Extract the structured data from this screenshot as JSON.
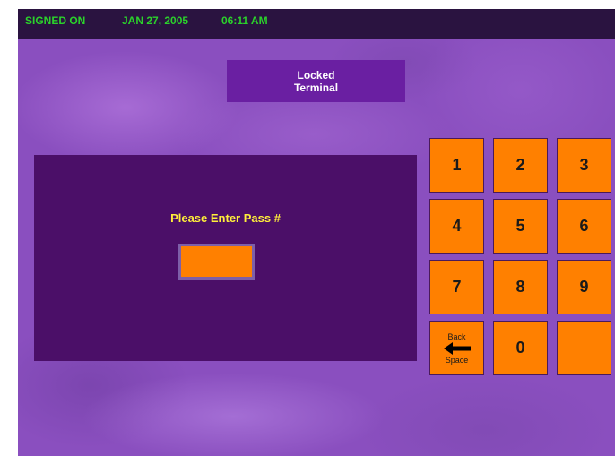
{
  "status_bar": {
    "status": "SIGNED ON",
    "date": "JAN 27, 2005",
    "time": "06:11 AM"
  },
  "title": {
    "line1": "Locked",
    "line2": "Terminal"
  },
  "pass_panel": {
    "prompt": "Please Enter Pass #",
    "value": ""
  },
  "keypad": {
    "keys": [
      "1",
      "2",
      "3",
      "4",
      "5",
      "6",
      "7",
      "8",
      "9"
    ],
    "zero": "0",
    "backspace_top": "Back",
    "backspace_bottom": "Space",
    "backspace_icon": "arrow-left-icon"
  },
  "colors": {
    "background": "#8a4fbf",
    "status_bar": "#2a1340",
    "status_text": "#2bd22b",
    "title_box": "#6a1fa2",
    "panel": "#4b0f68",
    "prompt_text": "#ffef3a",
    "key": "#ff8000"
  }
}
